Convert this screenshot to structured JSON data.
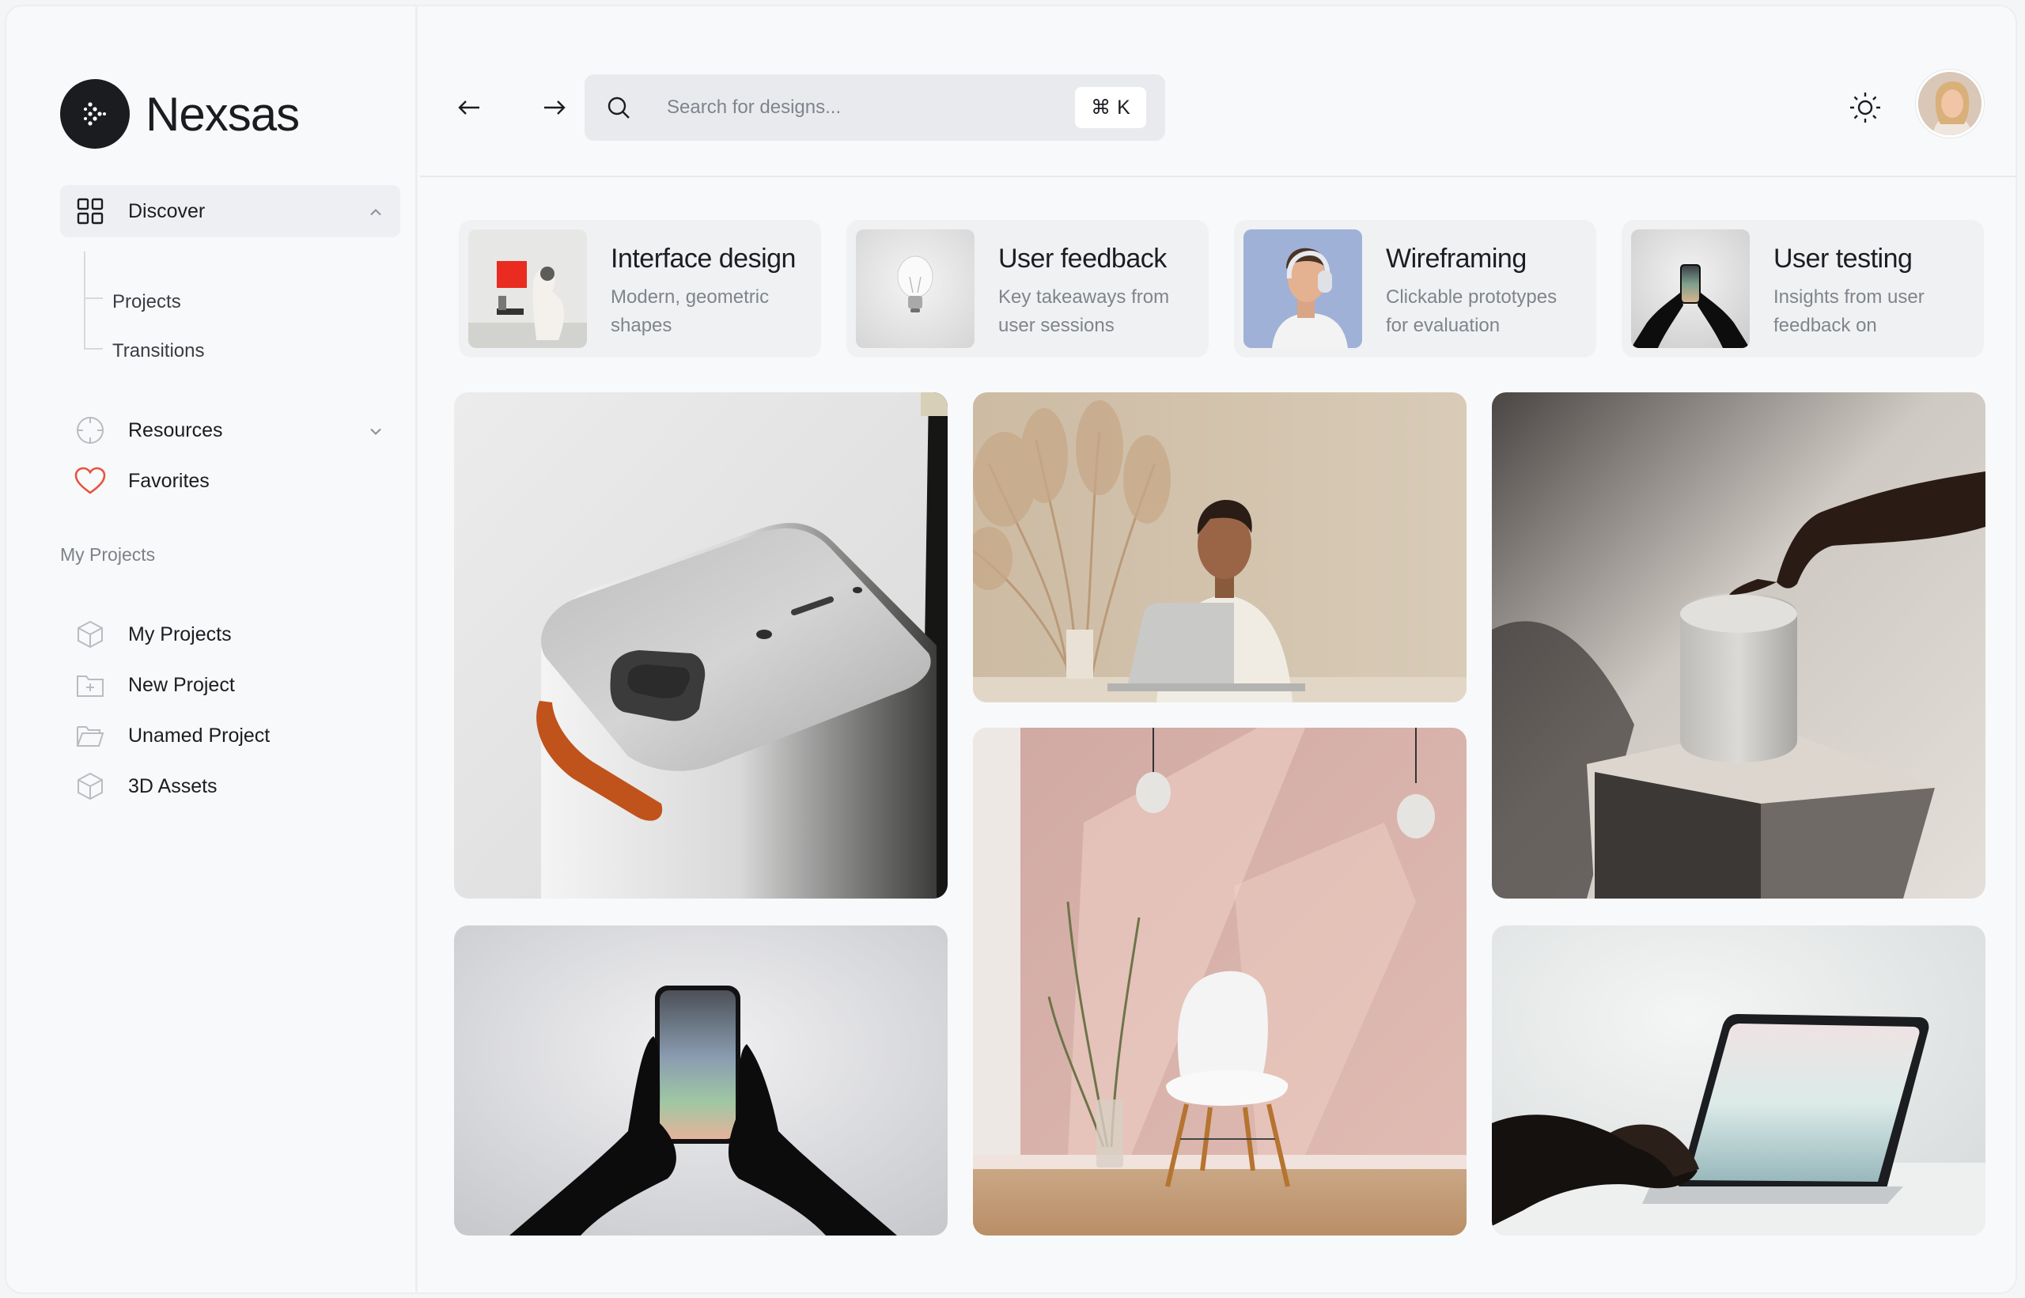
{
  "brand": {
    "name": "Nexsas"
  },
  "sidebar": {
    "discover": {
      "label": "Discover",
      "children": [
        "Projects",
        "Transitions"
      ]
    },
    "resources_label": "Resources",
    "favorites_label": "Favorites",
    "section_label": "My Projects",
    "projects": [
      "My Projects",
      "New Project",
      "Unamed Project",
      "3D Assets"
    ]
  },
  "header": {
    "search_placeholder": "Search for designs...",
    "shortcut_key": "K"
  },
  "cards": [
    {
      "title": "Interface design",
      "desc": "Modern, geometric shapes"
    },
    {
      "title": "User feedback",
      "desc": "Key takeaways from user sessions"
    },
    {
      "title": "Wireframing",
      "desc": "Clickable prototypes for evaluation"
    },
    {
      "title": "User testing",
      "desc": "Insights from user feedback on"
    }
  ],
  "colors": {
    "accent_heart": "#e8523f",
    "logo_bg": "#1a1c20"
  }
}
